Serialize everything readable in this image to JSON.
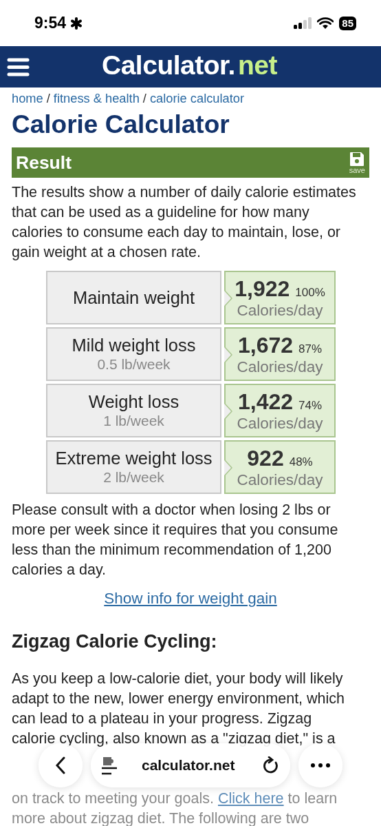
{
  "status_bar": {
    "time": "9:54",
    "battery": "85"
  },
  "header": {
    "logo_main": "Calculator.",
    "logo_tld": "net"
  },
  "breadcrumb": {
    "separator": "/",
    "items": [
      {
        "label": "home"
      },
      {
        "label": "fitness & health"
      },
      {
        "label": "calorie calculator"
      }
    ]
  },
  "title": "Calorie Calculator",
  "result_bar": {
    "title": "Result",
    "save_label": "save"
  },
  "intro": "The results show a number of daily calorie estimates that can be used as a guideline for how many calories to consume each day to maintain, lose, or gain weight at a chosen rate.",
  "estimates": [
    {
      "label": "Maintain weight",
      "calories": "1,922",
      "percent": "100%",
      "unit": "Calories/day"
    },
    {
      "label": "Mild weight loss",
      "rate": "0.5 lb/week",
      "calories": "1,672",
      "percent": "87%",
      "unit": "Calories/day"
    },
    {
      "label": "Weight loss",
      "rate": "1 lb/week",
      "calories": "1,422",
      "percent": "74%",
      "unit": "Calories/day"
    },
    {
      "label": "Extreme weight loss",
      "rate": "2 lb/week",
      "calories": "922",
      "percent": "48%",
      "unit": "Calories/day"
    }
  ],
  "note": "Please consult with a doctor when losing 2 lbs or more per week since it requires that you consume less than the minimum recommendation of 1,200 calories a day.",
  "weight_gain_link": "Show info for weight gain",
  "section_heading": "Zigzag Calorie Cycling:",
  "zigzag_text": "As you keep a low-calorie diet, your body will likely adapt to the new, lower energy environment, which can lead to a plateau in your progress. Zigzag calorie cycling, also known as a \"zigzag diet,\" is a",
  "zigzag_faded": [
    {
      "text": "on track to meeting your goals. ",
      "link": "Click here",
      "after": " to learn"
    },
    {
      "text": "more about zigzag diet. The following are two"
    }
  ],
  "browser_bar": {
    "url": "calculator.net"
  }
}
